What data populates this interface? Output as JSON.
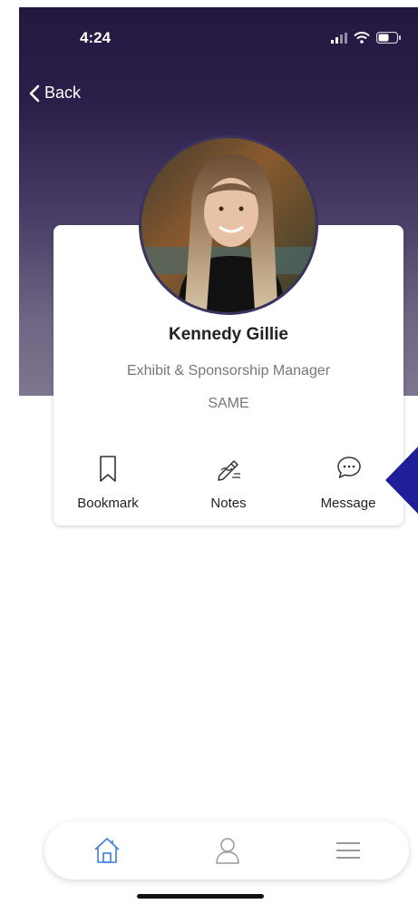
{
  "status_bar": {
    "time": "4:24"
  },
  "nav": {
    "back_label": "Back"
  },
  "profile": {
    "name": "Kennedy Gillie",
    "title": "Exhibit & Sponsorship Manager",
    "organization": "SAME"
  },
  "actions": [
    {
      "label": "Bookmark",
      "icon": "bookmark-icon"
    },
    {
      "label": "Notes",
      "icon": "notes-icon"
    },
    {
      "label": "Message",
      "icon": "message-icon"
    }
  ],
  "tabbar": {
    "tabs": [
      {
        "icon": "home-icon",
        "active": true
      },
      {
        "icon": "profile-icon",
        "active": false
      },
      {
        "icon": "menu-icon",
        "active": false
      }
    ]
  },
  "colors": {
    "hero_top": "#221840",
    "hero_bottom": "#7e768f",
    "active_tab": "#3b7ddd",
    "arrow": "#1f1f9a"
  }
}
